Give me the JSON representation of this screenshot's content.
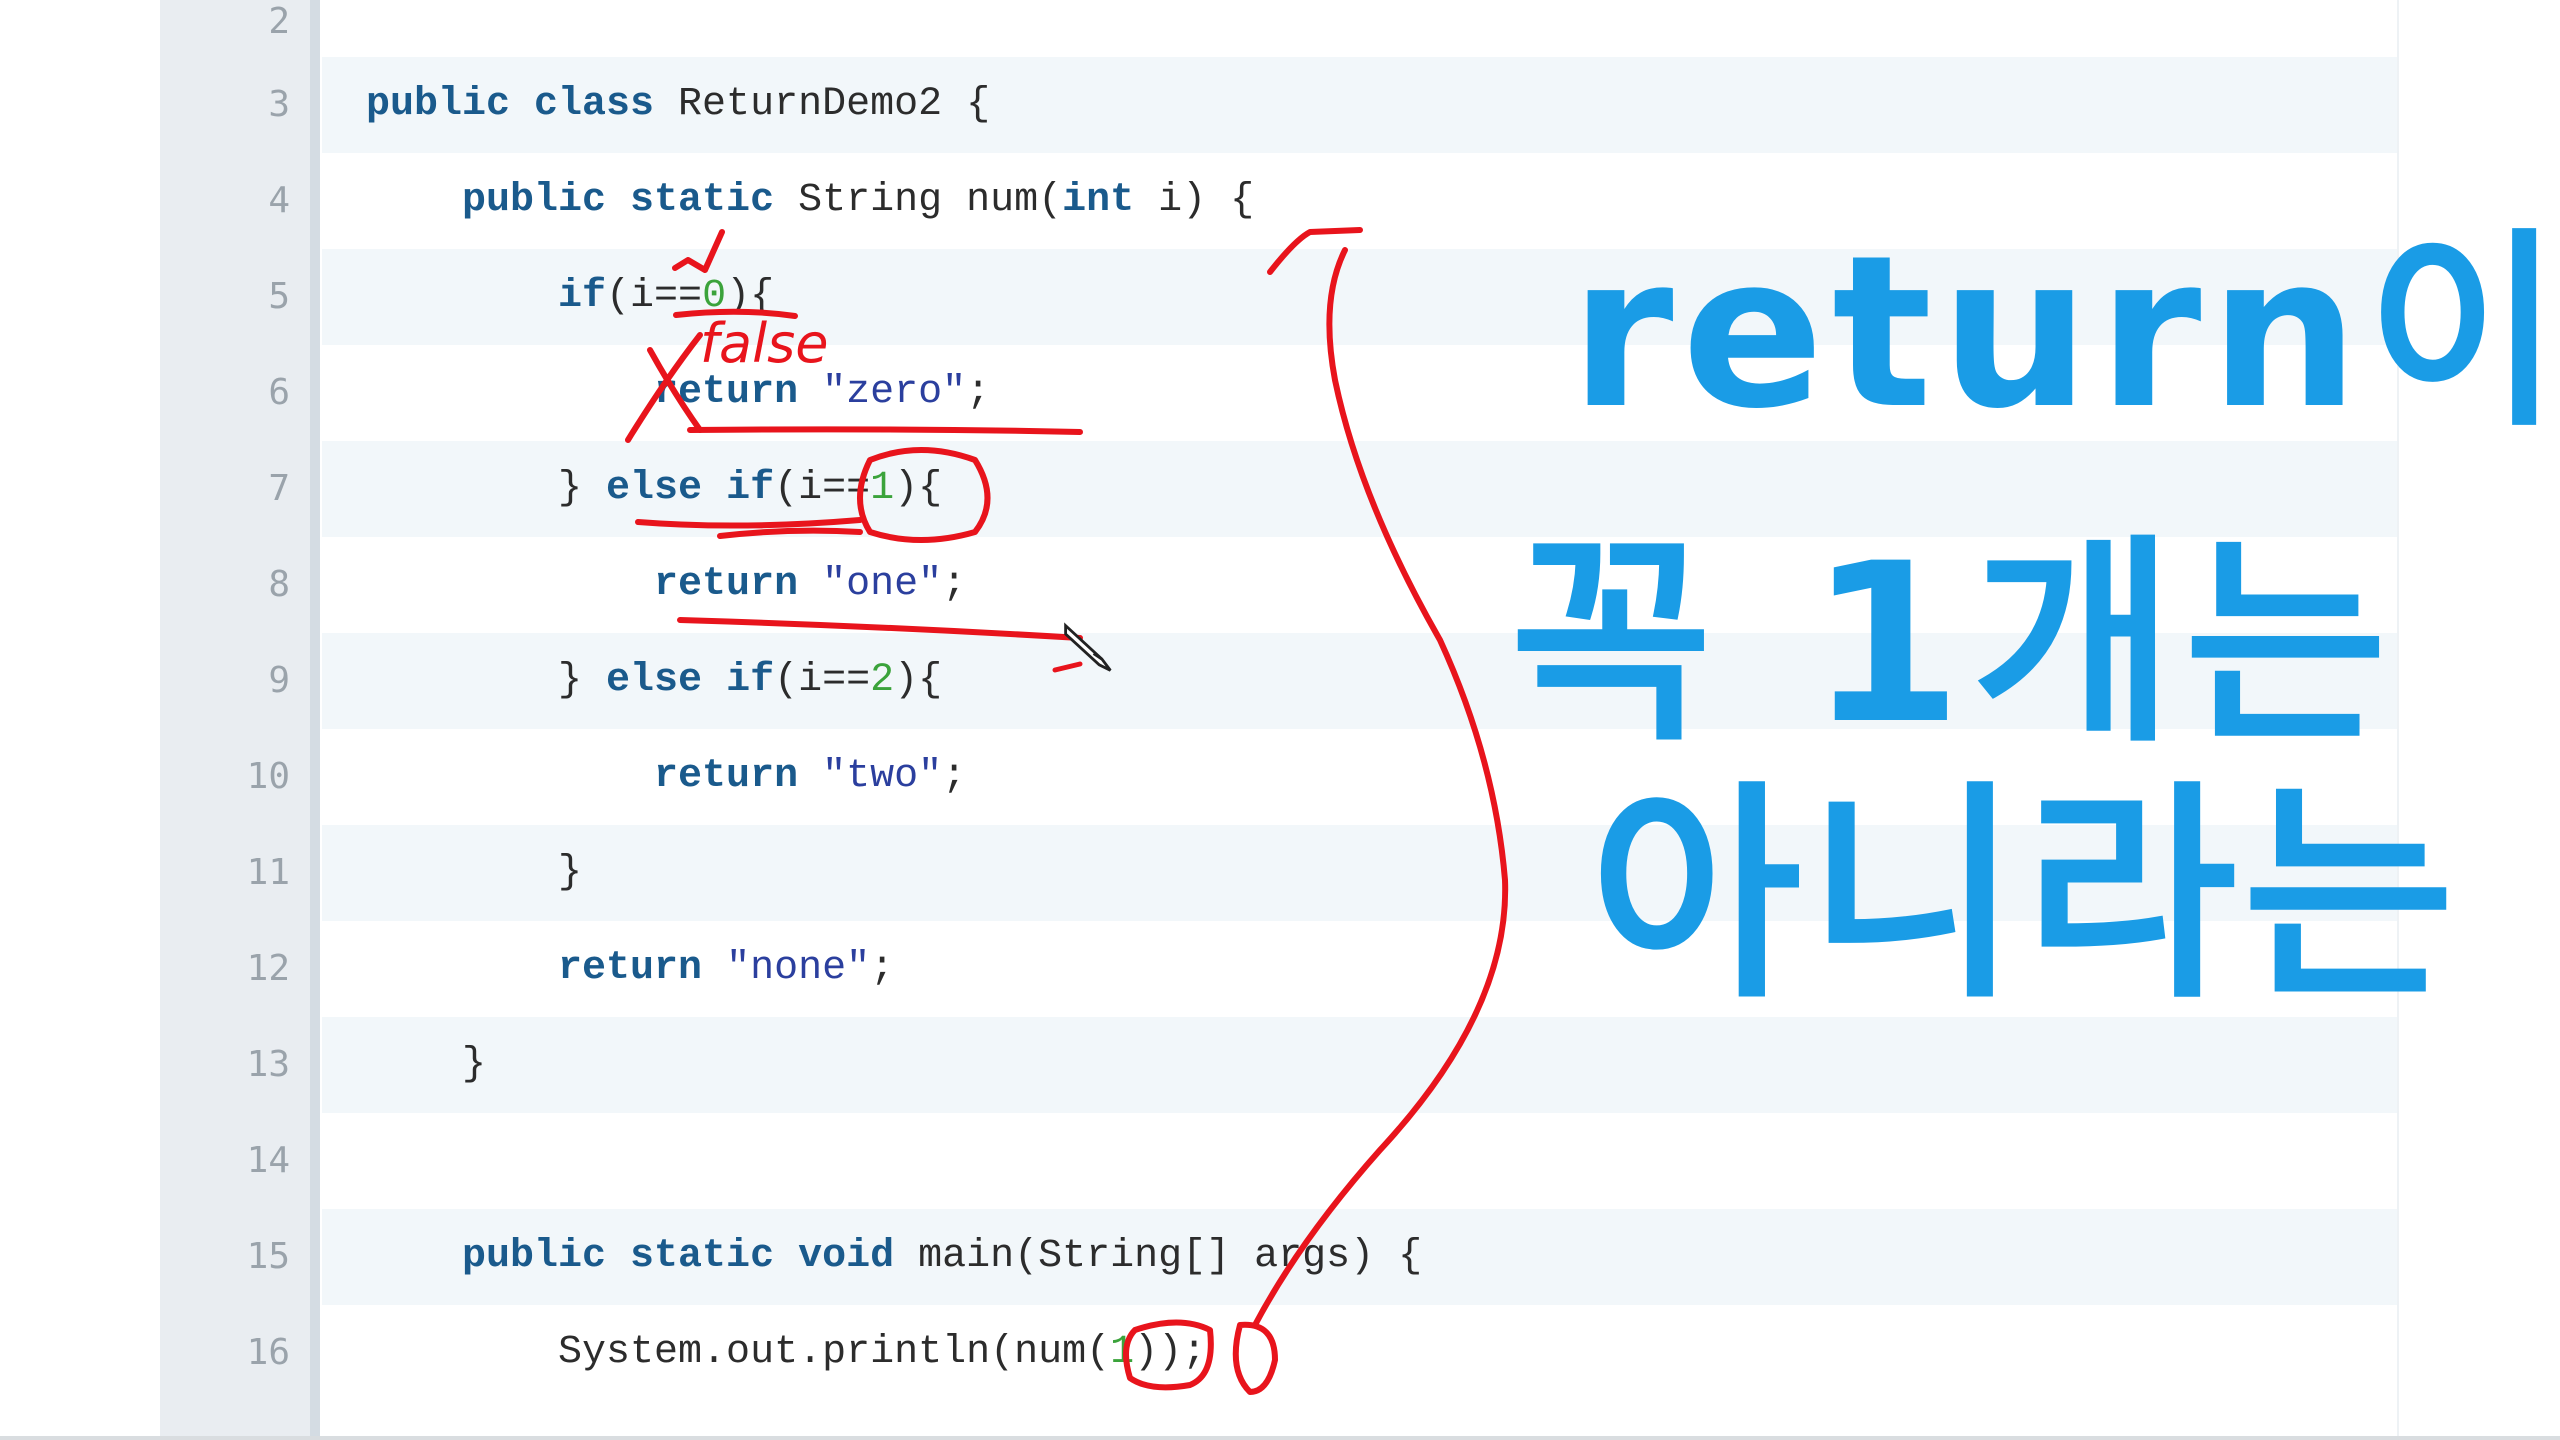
{
  "editor": {
    "partial_top_line_number": "2",
    "lines": [
      {
        "num": "3",
        "tokens": [
          {
            "t": "public class",
            "c": "kw"
          },
          {
            "t": " ReturnDemo2 {",
            "c": ""
          }
        ]
      },
      {
        "num": "4",
        "tokens": [
          {
            "t": "    ",
            "c": ""
          },
          {
            "t": "public static",
            "c": "kw"
          },
          {
            "t": " String num(",
            "c": ""
          },
          {
            "t": "int",
            "c": "kw"
          },
          {
            "t": " i) {",
            "c": ""
          }
        ]
      },
      {
        "num": "5",
        "tokens": [
          {
            "t": "        ",
            "c": ""
          },
          {
            "t": "if",
            "c": "kw"
          },
          {
            "t": "(i==",
            "c": ""
          },
          {
            "t": "0",
            "c": "num"
          },
          {
            "t": "){",
            "c": ""
          }
        ]
      },
      {
        "num": "6",
        "tokens": [
          {
            "t": "            ",
            "c": ""
          },
          {
            "t": "return",
            "c": "kw"
          },
          {
            "t": " ",
            "c": ""
          },
          {
            "t": "\"zero\"",
            "c": "str"
          },
          {
            "t": ";",
            "c": ""
          }
        ]
      },
      {
        "num": "7",
        "tokens": [
          {
            "t": "        } ",
            "c": ""
          },
          {
            "t": "else if",
            "c": "kw"
          },
          {
            "t": "(i==",
            "c": ""
          },
          {
            "t": "1",
            "c": "num"
          },
          {
            "t": "){",
            "c": ""
          }
        ]
      },
      {
        "num": "8",
        "tokens": [
          {
            "t": "            ",
            "c": ""
          },
          {
            "t": "return",
            "c": "kw"
          },
          {
            "t": " ",
            "c": ""
          },
          {
            "t": "\"one\"",
            "c": "str"
          },
          {
            "t": ";",
            "c": ""
          }
        ]
      },
      {
        "num": "9",
        "tokens": [
          {
            "t": "        } ",
            "c": ""
          },
          {
            "t": "else if",
            "c": "kw"
          },
          {
            "t": "(i==",
            "c": ""
          },
          {
            "t": "2",
            "c": "num"
          },
          {
            "t": "){",
            "c": ""
          }
        ]
      },
      {
        "num": "10",
        "tokens": [
          {
            "t": "            ",
            "c": ""
          },
          {
            "t": "return",
            "c": "kw"
          },
          {
            "t": " ",
            "c": ""
          },
          {
            "t": "\"two\"",
            "c": "str"
          },
          {
            "t": ";",
            "c": ""
          }
        ]
      },
      {
        "num": "11",
        "tokens": [
          {
            "t": "        }",
            "c": ""
          }
        ]
      },
      {
        "num": "12",
        "tokens": [
          {
            "t": "        ",
            "c": ""
          },
          {
            "t": "return",
            "c": "kw"
          },
          {
            "t": " ",
            "c": ""
          },
          {
            "t": "\"none\"",
            "c": "str"
          },
          {
            "t": ";",
            "c": ""
          }
        ]
      },
      {
        "num": "13",
        "tokens": [
          {
            "t": "    }",
            "c": ""
          }
        ]
      },
      {
        "num": "14",
        "tokens": []
      },
      {
        "num": "15",
        "tokens": [
          {
            "t": "    ",
            "c": ""
          },
          {
            "t": "public static void",
            "c": "kw"
          },
          {
            "t": " main(String[] args) {",
            "c": ""
          }
        ]
      },
      {
        "num": "16",
        "tokens": [
          {
            "t": "        System.out.println(num(",
            "c": ""
          },
          {
            "t": "1",
            "c": "num"
          },
          {
            "t": "));",
            "c": ""
          }
        ]
      }
    ]
  },
  "annotations": {
    "handwritten_false": "false",
    "handwritten_note_line1": "return이",
    "handwritten_note_line2": "꼭 1개는",
    "handwritten_note_line3": "아니라는",
    "red_ink": "#e8141c",
    "blue_ink": "#1a9ce6"
  },
  "colors": {
    "keyword": "#1a5a8c",
    "string": "#2b3f9e",
    "number": "#3ba33b",
    "gutter": "#e9edf1",
    "stripe": "#f2f7fa"
  }
}
